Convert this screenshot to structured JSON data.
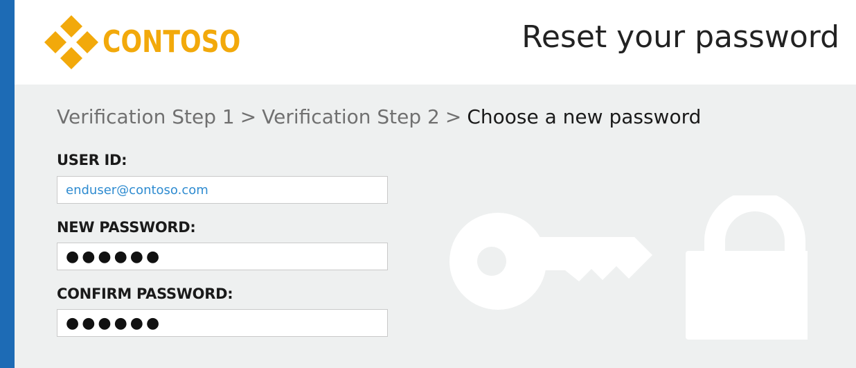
{
  "brand": {
    "name": "CONTOSO",
    "color": "#f2a90b",
    "accent": "#1d6bb5"
  },
  "header": {
    "title": "Reset your password"
  },
  "breadcrumb": {
    "steps": [
      "Verification Step 1",
      "Verification Step 2",
      "Choose a new password"
    ],
    "separator": ">"
  },
  "form": {
    "user_id": {
      "label": "USER ID:",
      "value": "enduser@contoso.com"
    },
    "new_password": {
      "label": "NEW PASSWORD:",
      "value": "●●●●●●"
    },
    "confirm_password": {
      "label": "CONFIRM PASSWORD:",
      "value": "●●●●●●"
    }
  },
  "illustration": {
    "icons": [
      "key-icon",
      "lock-icon"
    ]
  }
}
